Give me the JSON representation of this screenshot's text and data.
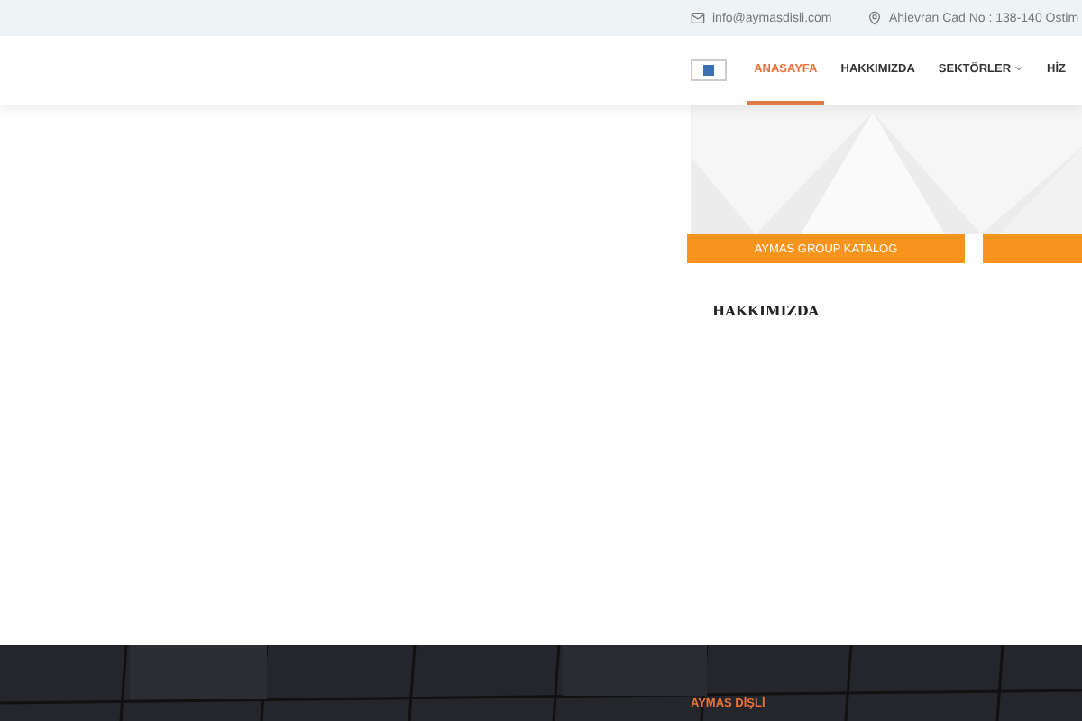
{
  "top_bar": {
    "email": "info@aymasdisli.com",
    "address": "Ahievran Cad No : 138-140 Ostim"
  },
  "nav": {
    "items": [
      {
        "label": "ANASAYFA",
        "selected": true,
        "dropdown": false
      },
      {
        "label": "HAKKIMIZDA",
        "selected": false,
        "dropdown": false
      },
      {
        "label": "SEKTÖRLER",
        "selected": false,
        "dropdown": true
      },
      {
        "label": "HİZ",
        "selected": false,
        "dropdown": false
      }
    ]
  },
  "buttons": [
    {
      "label": "AYMAS GROUP KATALOG"
    }
  ],
  "section_title": "HAKKIMIZDA",
  "footer": {
    "title": "AYMAS DİŞLİ"
  }
}
